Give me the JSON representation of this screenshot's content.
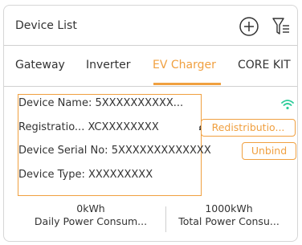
{
  "header": {
    "title": "Device List"
  },
  "tabs": [
    {
      "label": "Gateway"
    },
    {
      "label": "Inverter"
    },
    {
      "label": "EV Charger"
    },
    {
      "label": "CORE KIT"
    }
  ],
  "active_tab": "EV Charger",
  "device": {
    "name": "Device Name: 5XXXXXXXXXX...",
    "registration": "Registratio... XCXXXXXXXX",
    "serial": "Device Serial No: 5XXXXXXXXXXXXX",
    "type": "Device Type: XXXXXXXXX"
  },
  "buttons": {
    "redistribution": "Redistributio...",
    "unbind": "Unbind"
  },
  "stats": [
    {
      "value": "0kWh",
      "label": "Daily Power Consum..."
    },
    {
      "value": "1000kWh",
      "label": "Total Power Consu..."
    }
  ],
  "colors": {
    "accent": "#f0a040",
    "wifi": "#2ecc9a",
    "text": "#333333",
    "border": "#d6d6d6"
  },
  "icons": {
    "add": "add-circle-icon",
    "filter": "filter-icon",
    "edit": "edit-icon",
    "wifi": "wifi-icon"
  }
}
